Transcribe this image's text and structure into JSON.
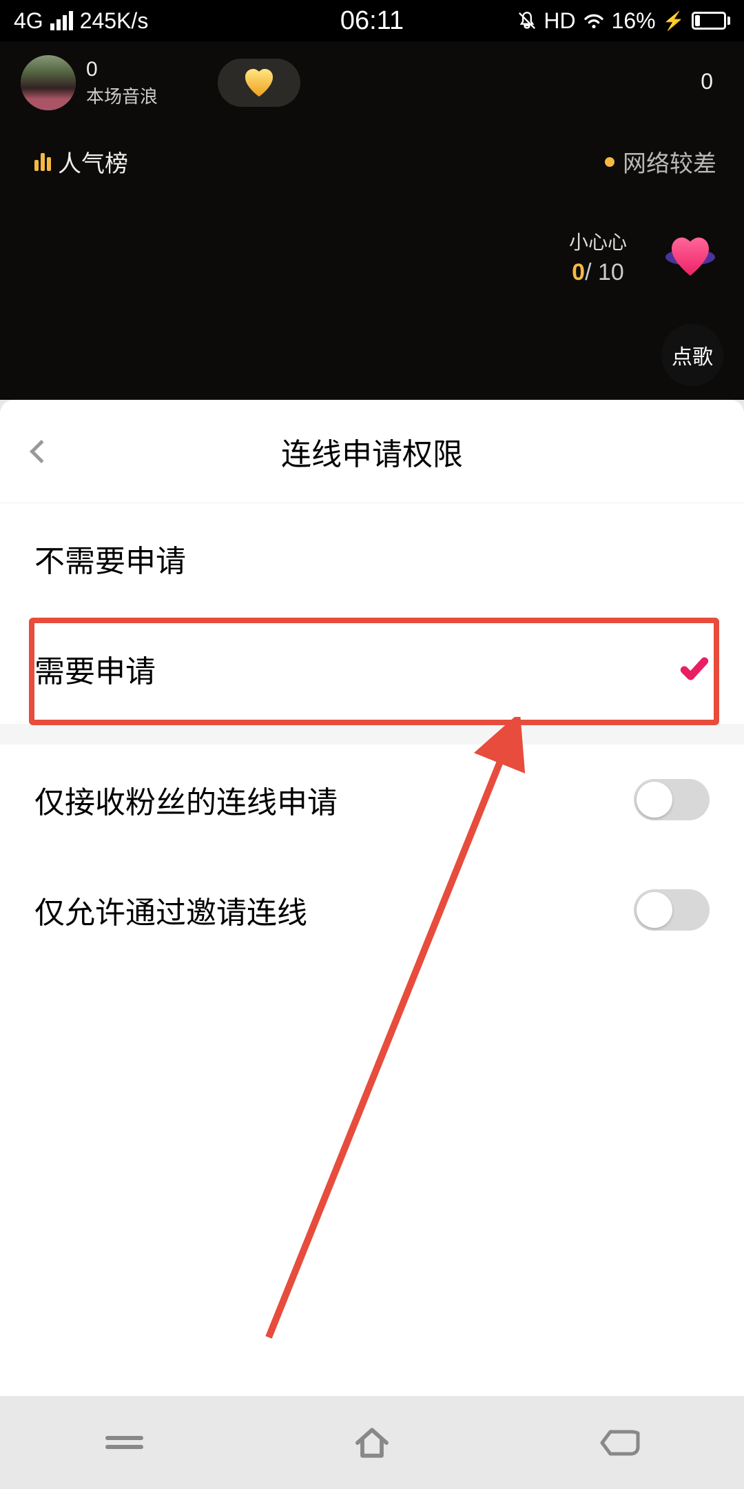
{
  "status_bar": {
    "network_type": "4G",
    "speed": "245K/s",
    "time": "06:11",
    "hd": "HD",
    "battery_percent": "16%"
  },
  "live": {
    "sound_wave_count": "0",
    "sound_wave_label": "本场音浪",
    "viewer_count": "0",
    "rank_label": "人气榜",
    "network_label": "网络较差",
    "heart_label": "小心心",
    "heart_current": "0",
    "heart_total": "/ 10",
    "song_button": "点歌"
  },
  "panel": {
    "title": "连线申请权限",
    "options": [
      {
        "label": "不需要申请",
        "selected": false
      },
      {
        "label": "需要申请",
        "selected": true
      }
    ],
    "toggles": [
      {
        "label": "仅接收粉丝的连线申请",
        "on": false
      },
      {
        "label": "仅允许通过邀请连线",
        "on": false
      }
    ]
  }
}
